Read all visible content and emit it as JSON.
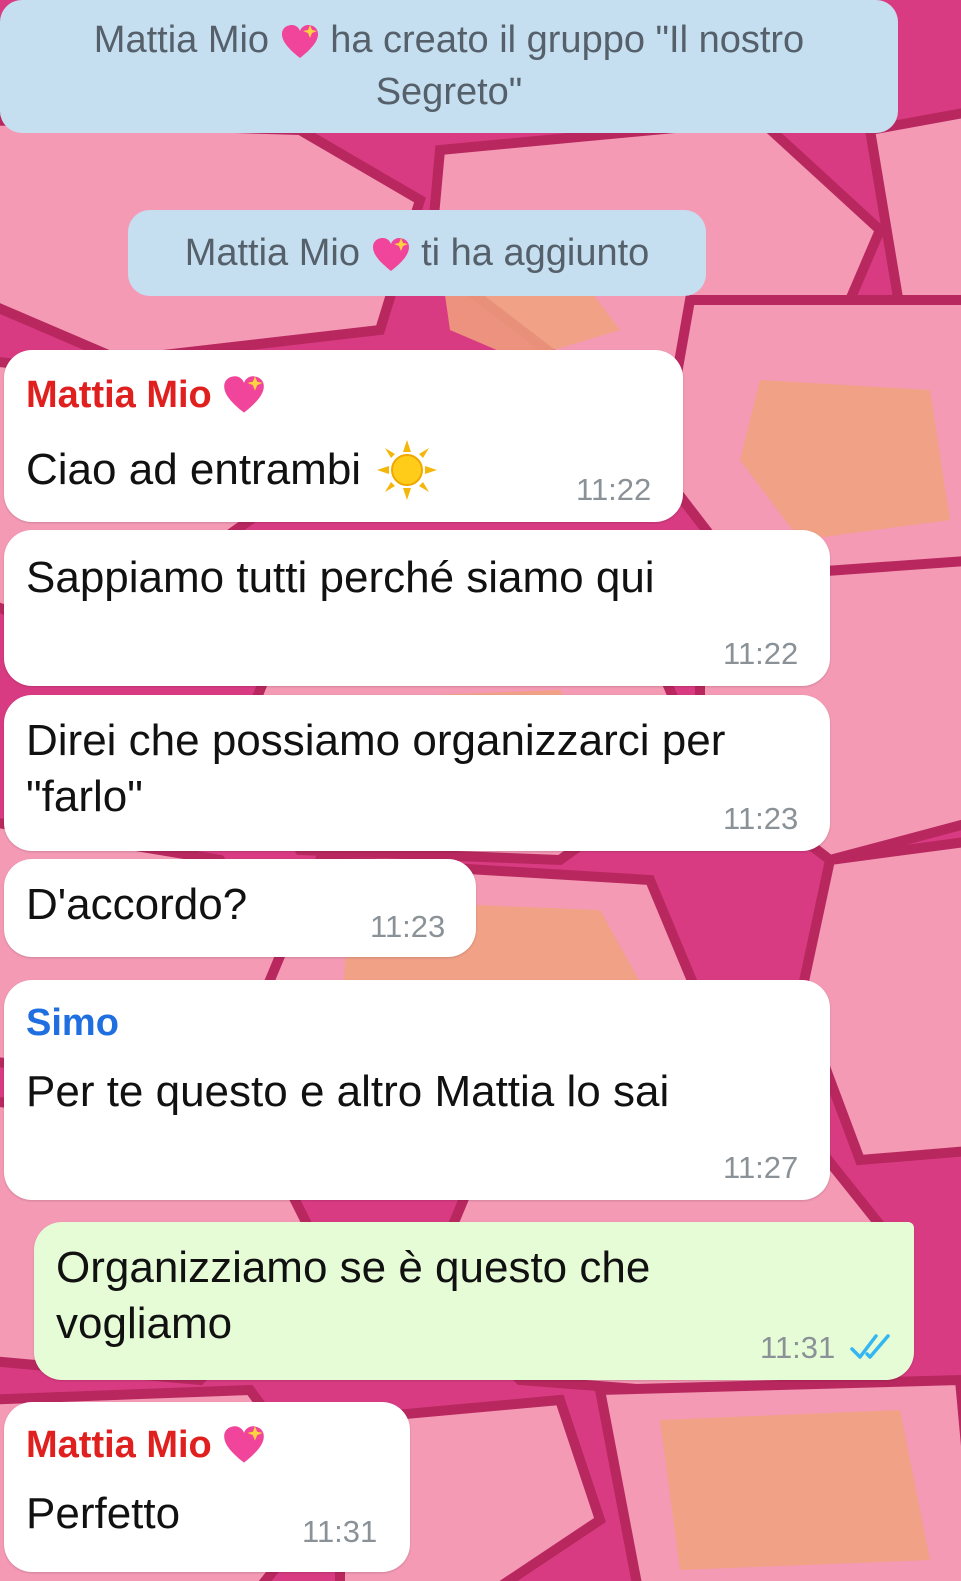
{
  "colors": {
    "sender_mattia": "#e0201f",
    "sender_simo": "#1f6fe0",
    "system_bg": "#c5dff0",
    "outgoing_bg": "#e6fcd6",
    "incoming_bg": "#ffffff",
    "read_ticks": "#34b7f1"
  },
  "system_messages": {
    "created": {
      "name": "Mattia Mio",
      "heart": "sparkling-heart-icon",
      "text_line1": "ha creato il gruppo \"Il nostro",
      "text_line2": "Segreto\""
    },
    "added": {
      "name": "Mattia Mio",
      "heart": "sparkling-heart-icon",
      "text": "ti ha aggiunto"
    }
  },
  "messages": [
    {
      "sender": "Mattia Mio",
      "text": "Ciao ad entrambi",
      "emoji": "sun-icon",
      "time": "11:22"
    },
    {
      "text": "Sappiamo tutti perché siamo qui",
      "time": "11:22"
    },
    {
      "text_line1": "Direi che possiamo organizzarci per",
      "text_line2": "\"farlo\"",
      "time": "11:23"
    },
    {
      "text": "D'accordo?",
      "time": "11:23"
    },
    {
      "sender": "Simo",
      "text": "Per te questo e altro Mattia lo sai",
      "time": "11:27"
    },
    {
      "text_line1": "Organizziamo se è questo che",
      "text_line2": "vogliamo",
      "time": "11:31",
      "status": "read-double-check-icon"
    },
    {
      "sender": "Mattia Mio",
      "text": "Perfetto",
      "time": "11:31"
    }
  ]
}
